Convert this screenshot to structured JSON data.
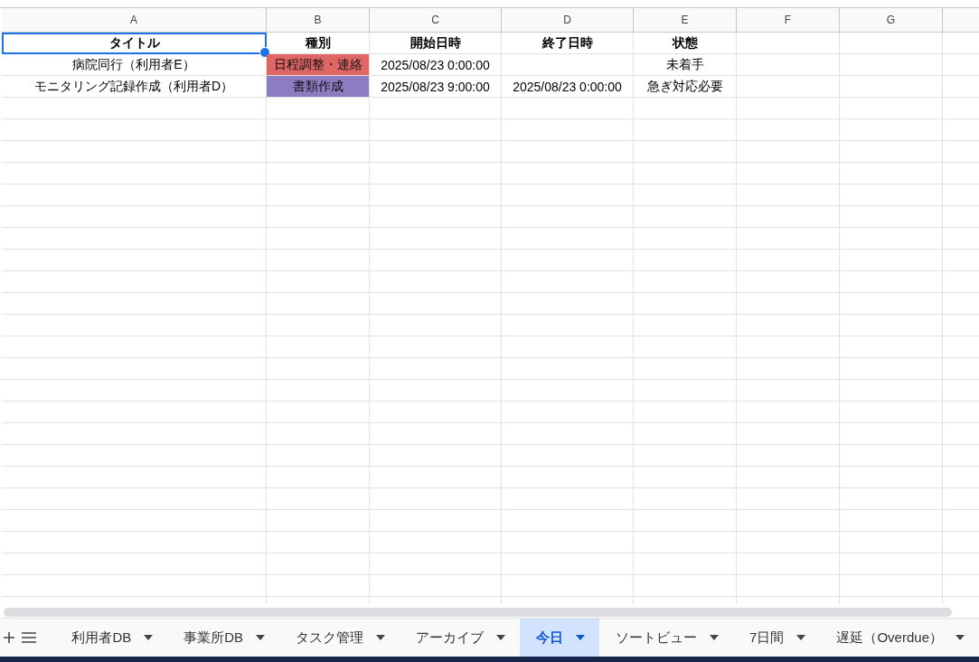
{
  "columns": [
    "A",
    "B",
    "C",
    "D",
    "E",
    "F",
    "G"
  ],
  "rows": [
    {
      "kind": "header",
      "cells": [
        {
          "text": "タイトル",
          "selected": true
        },
        {
          "text": "種別",
          "selected": false
        },
        {
          "text": "開始日時",
          "selected": false
        },
        {
          "text": "終了日時",
          "selected": false
        },
        {
          "text": "状態",
          "selected": false
        }
      ]
    },
    {
      "kind": "data",
      "cells": [
        {
          "text": "病院同行（利用者E）",
          "selected": false
        },
        {
          "text": "日程調整・連絡",
          "color": "#e06666",
          "selected": false
        },
        {
          "text": "2025/08/23 0:00:00",
          "selected": false
        },
        {
          "selected": false
        },
        {
          "text": "未着手",
          "selected": false
        }
      ]
    },
    {
      "kind": "data",
      "cells": [
        {
          "text": "モニタリング記録作成（利用者D）",
          "selected": false
        },
        {
          "text": "書類作成",
          "color": "#8e7cc3",
          "selected": false
        },
        {
          "text": "2025/08/23 9:00:00",
          "selected": false
        },
        {
          "text": "2025/08/23 0:00:00",
          "selected": false
        },
        {
          "text": "急ぎ対応必要",
          "selected": false
        }
      ]
    }
  ],
  "sheet_tabs": [
    {
      "label": "利用者DB",
      "selected": false
    },
    {
      "label": "事業所DB",
      "selected": false
    },
    {
      "label": "タスク管理",
      "selected": false
    },
    {
      "label": "アーカイブ",
      "selected": false
    },
    {
      "label": "今日",
      "selected": true
    },
    {
      "label": "ソートビュー",
      "selected": false
    },
    {
      "label": "7日間",
      "selected": false
    },
    {
      "label": "遅延（Overdue）",
      "selected": false
    }
  ]
}
